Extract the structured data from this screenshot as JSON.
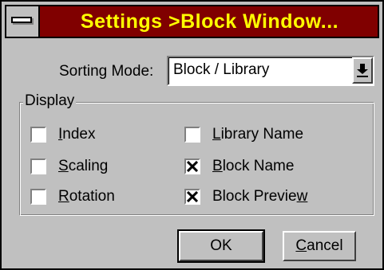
{
  "window": {
    "title": "Settings >Block Window..."
  },
  "sorting": {
    "label": "Sorting Mode:",
    "value": "Block / Library"
  },
  "display": {
    "group_label": "Display",
    "options": [
      {
        "label_pre": "",
        "label_ul": "I",
        "label_post": "ndex",
        "checked": false
      },
      {
        "label_pre": "",
        "label_ul": "S",
        "label_post": "caling",
        "checked": false
      },
      {
        "label_pre": "",
        "label_ul": "R",
        "label_post": "otation",
        "checked": false
      },
      {
        "label_pre": "",
        "label_ul": "L",
        "label_post": "ibrary Name",
        "checked": false
      },
      {
        "label_pre": "",
        "label_ul": "B",
        "label_post": "lock Name",
        "checked": true
      },
      {
        "label_pre": "Block Previe",
        "label_ul": "w",
        "label_post": "",
        "checked": true
      }
    ]
  },
  "buttons": {
    "ok": "OK",
    "cancel_ul": "C",
    "cancel_rest": "ancel"
  },
  "colors": {
    "titlebar": "#800000",
    "title_text": "#ffff00",
    "face": "#c0c0c0"
  }
}
